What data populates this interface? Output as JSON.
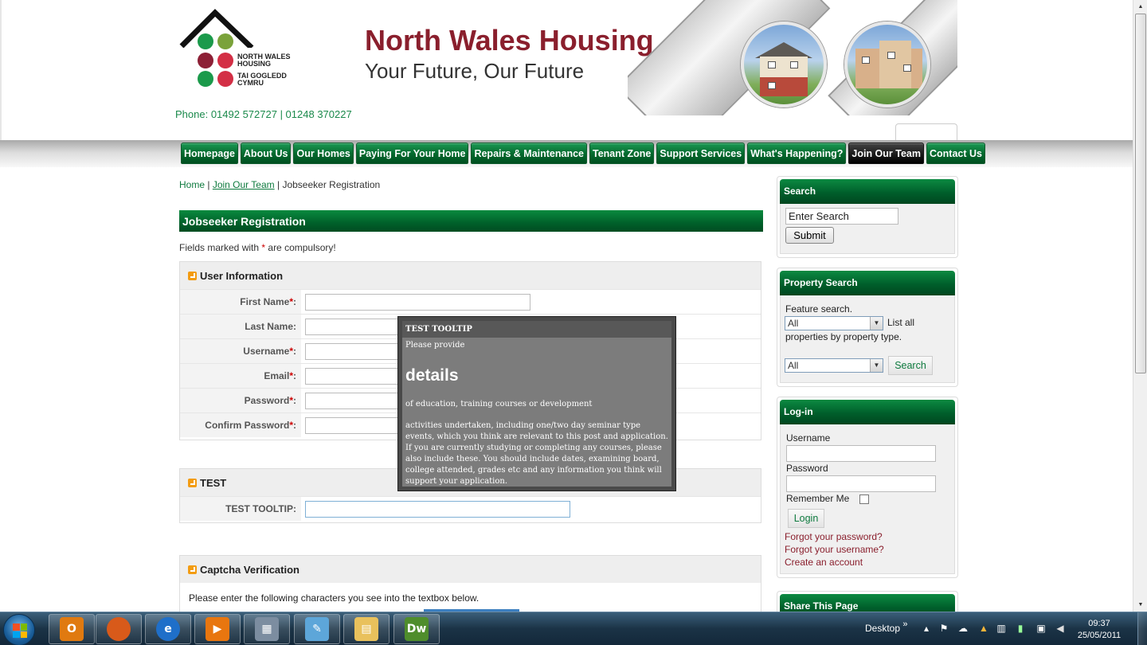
{
  "site": {
    "title": "North Wales Housing",
    "tagline": "Your Future, Our Future",
    "phone": "Phone: 01492 572727 | 01248 370227",
    "logo_lines": [
      "NORTH WALES",
      "HOUSING",
      "TAI GOGLEDD",
      "CYMRU"
    ]
  },
  "nav": {
    "items": [
      {
        "label": "Homepage"
      },
      {
        "label": "About Us"
      },
      {
        "label": "Our Homes"
      },
      {
        "label": "Paying For Your Home"
      },
      {
        "label": "Repairs & Maintenance"
      },
      {
        "label": "Tenant Zone"
      },
      {
        "label": "Support Services"
      },
      {
        "label": "What's Happening?"
      },
      {
        "label": "Join Our Team",
        "active": true
      },
      {
        "label": "Contact Us"
      }
    ]
  },
  "breadcrumb": {
    "home": "Home",
    "sep": "|",
    "parent": "Join Our Team",
    "current": "Jobseeker Registration"
  },
  "main": {
    "heading": "Jobseeker Registration",
    "note_prefix": "Fields marked with",
    "note_star": "*",
    "note_suffix": "are compulsory!",
    "user_info": {
      "legend": "User Information",
      "fields": [
        {
          "label": "First Name",
          "required": "*",
          "colon": ":"
        },
        {
          "label": "Last Name",
          "required": "",
          "colon": ":"
        },
        {
          "label": "Username",
          "required": "*",
          "colon": ":"
        },
        {
          "label": "Email",
          "required": "*",
          "colon": ":"
        },
        {
          "label": "Password",
          "required": "*",
          "colon": ":"
        },
        {
          "label": "Confirm Password",
          "required": "*",
          "colon": ":"
        }
      ]
    },
    "test": {
      "legend": "TEST",
      "field_label": "TEST TOOLTIP:"
    },
    "captcha": {
      "legend": "Captcha Verification",
      "instruction": "Please enter the following characters you see into the textbox below."
    }
  },
  "tooltip": {
    "title": "TEST TOOLTIP",
    "line1": "Please provide",
    "heading": "details",
    "line2": "of education, training courses or development",
    "paragraph": "activities undertaken, including one/two day seminar type events, which you think are relevant to this post and application. If you are currently studying or completing any courses, please also include these. You should include dates, examining board, college attended, grades etc and any information you think will support your application."
  },
  "sidebar": {
    "search": {
      "heading": "Search",
      "input_value": "Enter Search",
      "submit": "Submit"
    },
    "property": {
      "heading": "Property Search",
      "label": "Feature search.",
      "select1": "All",
      "list_all": "List all",
      "by_type": "properties by property type.",
      "select2": "All",
      "search_btn": "Search"
    },
    "login": {
      "heading": "Log-in",
      "username": "Username",
      "password": "Password",
      "remember": "Remember Me",
      "login_btn": "Login",
      "forgot_password": "Forgot your password?",
      "forgot_username": "Forgot your username?",
      "create": "Create an account"
    },
    "share": {
      "heading": "Share This Page"
    }
  },
  "taskbar": {
    "apps": [
      {
        "icon": "outlook-icon",
        "glyph": "O",
        "color": "#e07a10"
      },
      {
        "icon": "firefox-icon",
        "glyph": "",
        "color": "#d85a1a"
      },
      {
        "icon": "internet-explorer-icon",
        "glyph": "e",
        "color": "#1f6fc9"
      },
      {
        "icon": "media-player-icon",
        "glyph": "▶",
        "color": "#e8760f"
      },
      {
        "icon": "calculator-icon",
        "glyph": "▦",
        "color": "#7c8da0"
      },
      {
        "icon": "notepad-icon",
        "glyph": "✎",
        "color": "#5da6d9"
      },
      {
        "icon": "explorer-folder-icon",
        "glyph": "▤",
        "color": "#e9c15c"
      },
      {
        "icon": "dreamweaver-icon",
        "glyph": "Dw",
        "color": "#4f8d2c"
      }
    ],
    "desktop_label": "Desktop",
    "chevron": "»",
    "time": "09:37",
    "date": "25/05/2011"
  }
}
